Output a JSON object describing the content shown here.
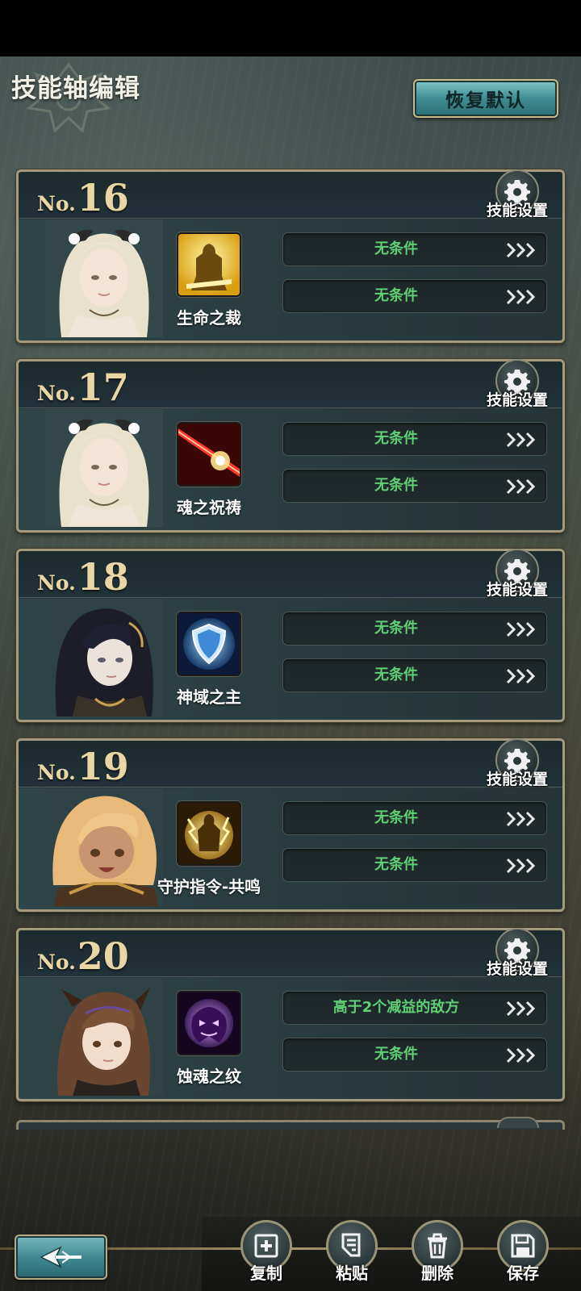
{
  "header": {
    "title": "技能轴编辑",
    "restore_default": "恢复默认"
  },
  "cards": [
    {
      "no_prefix": "No.",
      "number": "16",
      "skill_name": "生命之裁",
      "settings_label": "技能设置",
      "conditions": [
        "无条件",
        "无条件"
      ],
      "portrait": "elf-priestess-white-hair",
      "skill_icon": "golden-warrior-icon"
    },
    {
      "no_prefix": "No.",
      "number": "17",
      "skill_name": "魂之祝祷",
      "settings_label": "技能设置",
      "conditions": [
        "无条件",
        "无条件"
      ],
      "portrait": "elf-priestess-white-hair",
      "skill_icon": "red-beam-icon"
    },
    {
      "no_prefix": "No.",
      "number": "18",
      "skill_name": "神域之主",
      "settings_label": "技能设置",
      "conditions": [
        "无条件",
        "无条件"
      ],
      "portrait": "dark-hair-woman",
      "skill_icon": "blue-shield-icon"
    },
    {
      "no_prefix": "No.",
      "number": "19",
      "skill_name": "守护指令-共鸣",
      "settings_label": "技能设置",
      "conditions": [
        "无条件",
        "无条件"
      ],
      "portrait": "blonde-girl-armor",
      "skill_icon": "golden-lightning-icon"
    },
    {
      "no_prefix": "No.",
      "number": "20",
      "skill_name": "蚀魂之纹",
      "settings_label": "技能设置",
      "conditions": [
        "高于2个减益的敌方",
        "无条件"
      ],
      "portrait": "brown-hair-girl",
      "skill_icon": "purple-ghost-icon"
    }
  ],
  "toolbar": {
    "copy": "复制",
    "paste": "粘贴",
    "delete": "删除",
    "save": "保存"
  },
  "colors": {
    "condition_text": "#5fcf73",
    "number_gold": "#e9d6a5",
    "accent_teal": "#3e8d93"
  }
}
